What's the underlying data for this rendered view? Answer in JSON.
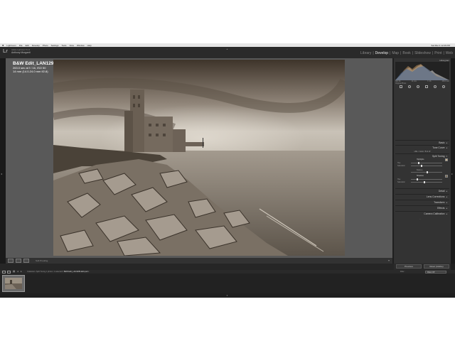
{
  "menubar": {
    "apple": "",
    "items": [
      "Lightroom",
      "File",
      "Edit",
      "Develop",
      "Photo",
      "Settings",
      "Tools",
      "View",
      "Window",
      "Help"
    ],
    "clock": "Sat Mar 4 12:26 PM"
  },
  "lr": {
    "logo": "Lr",
    "catalog": "Adobe Lightroom 5.2.4",
    "user": "Anthony Morganti",
    "modules": [
      "Library",
      "Develop",
      "Map",
      "Book",
      "Slideshow",
      "Print",
      "Web"
    ],
    "separator": "|",
    "active_module": "Develop"
  },
  "photo_info": {
    "filename": "B&W Edit_LAN1295-Edit.psd",
    "exposure": "263.0 sec at f / 16, ISO 50",
    "lens": "14 mm (14.0-24.0 mm f/2.8)"
  },
  "toolbar": {
    "soft_proofing": "Soft Proofing"
  },
  "right_panel": {
    "histogram_label": "Histogram",
    "readout": [
      "ISO 50",
      "14 mm",
      "f / 16",
      "263.0 sec"
    ],
    "original_photo": "Original Photo",
    "panels": [
      "Basic",
      "Tone Curve",
      "Split Toning",
      "Detail",
      "Lens Corrections",
      "Transform",
      "Effects",
      "Camera Calibration"
    ],
    "hsl_tabs": "HSL / Color / B & W",
    "split_labels": [
      "Highlights",
      "Hue",
      "Saturation",
      "Balance",
      "Shadows",
      "Hue",
      "Saturation"
    ],
    "previous": "Previous",
    "reset": "Reset (Adobe)"
  },
  "filmbar": {
    "collection": "Collection: Split Toning",
    "selection": "1 photo / 1 selected /",
    "file": "B&W Edit_LAN1295-Edit.psd",
    "filter_label": "Filter :",
    "filter_value": "Filters Off"
  },
  "colors": {
    "accent": "#ffffff",
    "panel_bg": "#333333",
    "center_bg": "#595959"
  }
}
